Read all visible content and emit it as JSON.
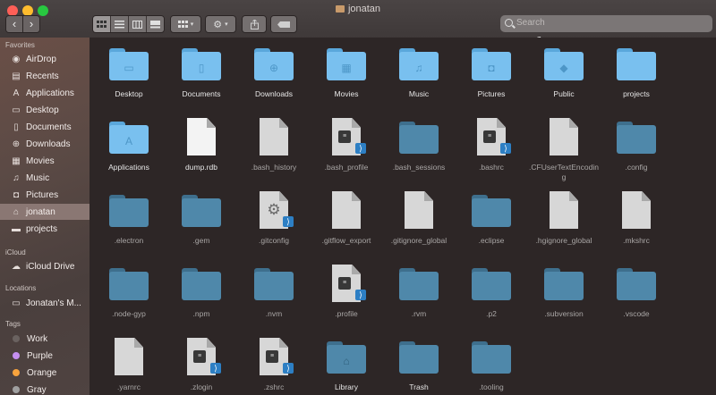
{
  "window": {
    "title": "jonatan"
  },
  "toolbar": {
    "back_glyph": "‹",
    "forward_glyph": "›",
    "view_modes": [
      "icon-view",
      "list-view",
      "column-view",
      "gallery-view"
    ],
    "search_placeholder": "Search"
  },
  "sidebar": {
    "favorites_header": "Favorites",
    "favorites": [
      {
        "label": "AirDrop",
        "icon": "airdrop-icon",
        "glyph": "◉"
      },
      {
        "label": "Recents",
        "icon": "recents-icon",
        "glyph": "▤"
      },
      {
        "label": "Applications",
        "icon": "applications-icon",
        "glyph": "A"
      },
      {
        "label": "Desktop",
        "icon": "desktop-icon",
        "glyph": "▭"
      },
      {
        "label": "Documents",
        "icon": "documents-icon",
        "glyph": "▯"
      },
      {
        "label": "Downloads",
        "icon": "downloads-icon",
        "glyph": "⊕"
      },
      {
        "label": "Movies",
        "icon": "movies-icon",
        "glyph": "▦"
      },
      {
        "label": "Music",
        "icon": "music-icon",
        "glyph": "♫"
      },
      {
        "label": "Pictures",
        "icon": "pictures-icon",
        "glyph": "◘"
      },
      {
        "label": "jonatan",
        "icon": "home-icon",
        "glyph": "⌂"
      },
      {
        "label": "projects",
        "icon": "folder-icon",
        "glyph": "▬"
      }
    ],
    "icloud_header": "iCloud",
    "icloud": [
      {
        "label": "iCloud Drive",
        "icon": "cloud-icon",
        "glyph": "☁"
      }
    ],
    "locations_header": "Locations",
    "locations": [
      {
        "label": "Jonatan's M...",
        "icon": "computer-icon",
        "glyph": "▭"
      }
    ],
    "tags_header": "Tags",
    "tags": [
      {
        "label": "Work",
        "color": "#6a6260"
      },
      {
        "label": "Purple",
        "color": "#c58ff0"
      },
      {
        "label": "Orange",
        "color": "#f7a33d"
      },
      {
        "label": "Gray",
        "color": "#a0a0a0"
      }
    ]
  },
  "files": [
    {
      "name": "Desktop",
      "kind": "folder-blue",
      "glyph": "▭"
    },
    {
      "name": "Documents",
      "kind": "folder-blue",
      "glyph": "▯"
    },
    {
      "name": "Downloads",
      "kind": "folder-blue",
      "glyph": "⊕"
    },
    {
      "name": "Movies",
      "kind": "folder-blue",
      "glyph": "▦"
    },
    {
      "name": "Music",
      "kind": "folder-blue",
      "glyph": "♫"
    },
    {
      "name": "Pictures",
      "kind": "folder-blue",
      "glyph": "◘"
    },
    {
      "name": "Public",
      "kind": "folder-blue",
      "glyph": "◆"
    },
    {
      "name": "projects",
      "kind": "folder-blue",
      "glyph": ""
    },
    {
      "name": "Applications",
      "kind": "folder-blue",
      "glyph": "A"
    },
    {
      "name": "dump.rdb",
      "kind": "doc-white"
    },
    {
      "name": ".bash_history",
      "kind": "doc"
    },
    {
      "name": ".bash_profile",
      "kind": "doc-code"
    },
    {
      "name": ".bash_sessions",
      "kind": "folder-dark",
      "glyph": ""
    },
    {
      "name": ".bashrc",
      "kind": "doc-code"
    },
    {
      "name": ".CFUserTextEncoding",
      "kind": "doc"
    },
    {
      "name": ".config",
      "kind": "folder-dark",
      "glyph": ""
    },
    {
      "name": ".electron",
      "kind": "folder-dark",
      "glyph": ""
    },
    {
      "name": ".gem",
      "kind": "folder-dark",
      "glyph": ""
    },
    {
      "name": ".gitconfig",
      "kind": "doc-gear"
    },
    {
      "name": ".gitflow_export",
      "kind": "doc"
    },
    {
      "name": ".gitignore_global",
      "kind": "doc"
    },
    {
      "name": ".eclipse",
      "kind": "folder-dark",
      "glyph": ""
    },
    {
      "name": ".hgignore_global",
      "kind": "doc"
    },
    {
      "name": ".mkshrc",
      "kind": "doc"
    },
    {
      "name": ".node-gyp",
      "kind": "folder-dark",
      "glyph": ""
    },
    {
      "name": ".npm",
      "kind": "folder-dark",
      "glyph": ""
    },
    {
      "name": ".nvm",
      "kind": "folder-dark",
      "glyph": ""
    },
    {
      "name": ".profile",
      "kind": "doc-code"
    },
    {
      "name": ".rvm",
      "kind": "folder-dark",
      "glyph": ""
    },
    {
      "name": ".p2",
      "kind": "folder-dark",
      "glyph": ""
    },
    {
      "name": ".subversion",
      "kind": "folder-dark",
      "glyph": ""
    },
    {
      "name": ".vscode",
      "kind": "folder-dark",
      "glyph": ""
    },
    {
      "name": ".yarnrc",
      "kind": "doc"
    },
    {
      "name": ".zlogin",
      "kind": "doc-code"
    },
    {
      "name": ".zshrc",
      "kind": "doc-code"
    },
    {
      "name": "Library",
      "kind": "folder-dark",
      "glyph": "⌂"
    },
    {
      "name": "Trash",
      "kind": "folder-dark",
      "glyph": ""
    },
    {
      "name": ".tooling",
      "kind": "folder-dark",
      "glyph": ""
    }
  ]
}
